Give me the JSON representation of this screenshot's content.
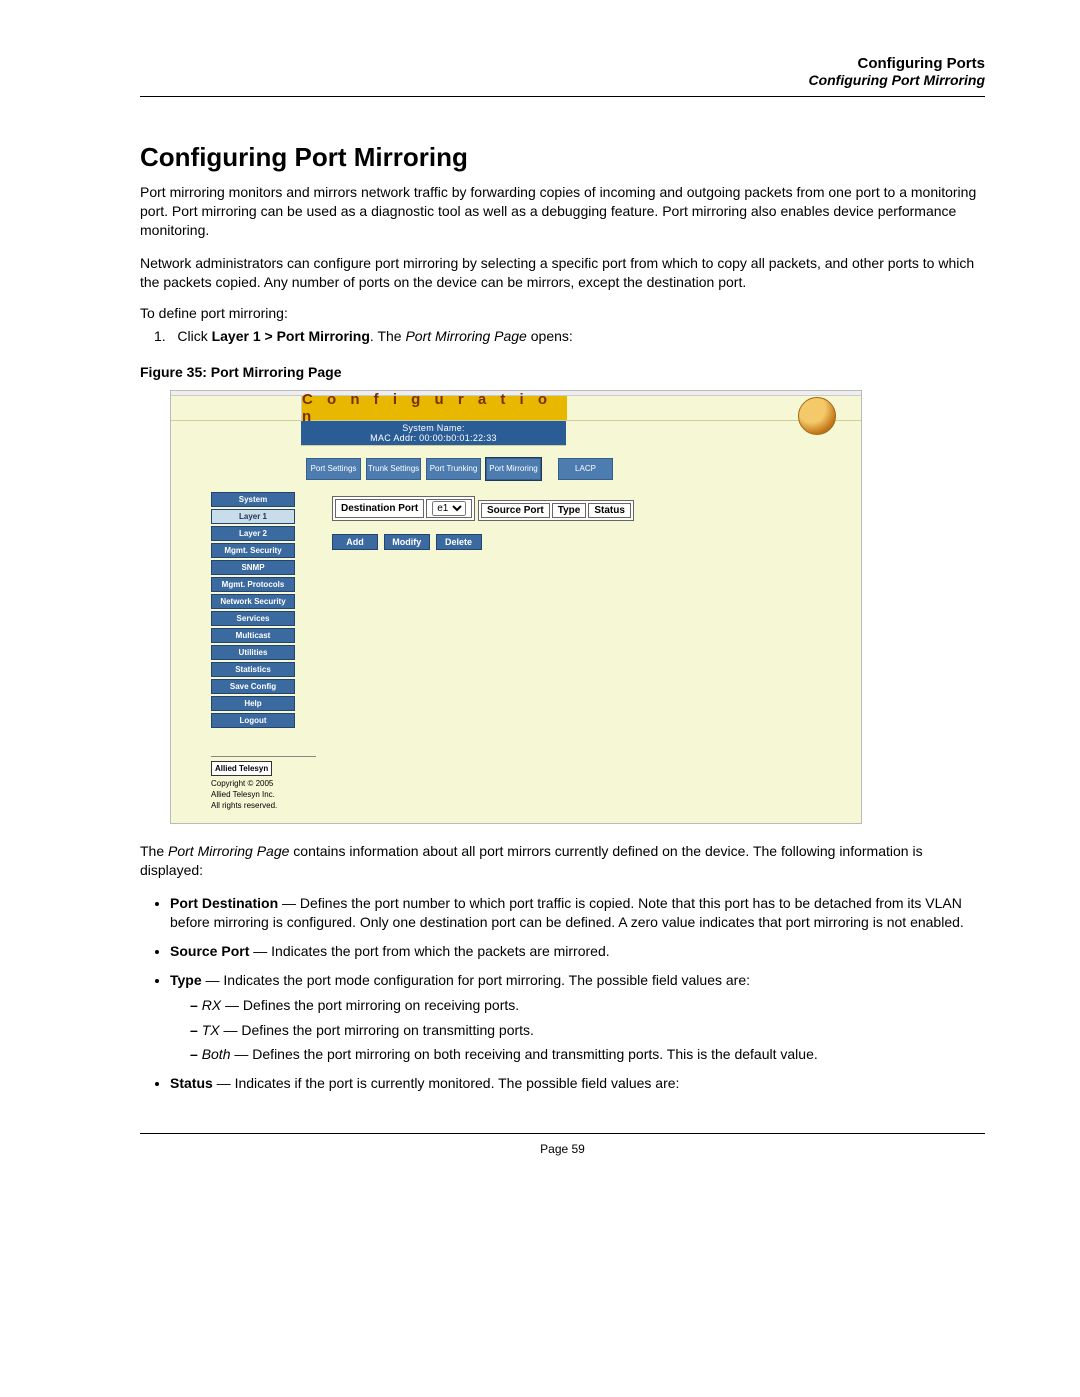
{
  "running_head": {
    "chapter": "Configuring Ports",
    "section": "Configuring Port Mirroring"
  },
  "heading": "Configuring Port Mirroring",
  "para1": "Port mirroring monitors and mirrors network traffic by forwarding copies of incoming and outgoing packets from one port to a monitoring port. Port mirroring can be used as a diagnostic tool as well as a debugging feature. Port mirroring also enables device performance monitoring.",
  "para2": "Network administrators can configure port mirroring by selecting a specific port from which to copy all packets, and other ports to which the packets copied. Any number of ports on the device can be mirrors, except the destination port.",
  "lead": "To define port mirroring:",
  "step1": {
    "num": "1.",
    "pre": "Click ",
    "bold": "Layer 1 > Port Mirroring",
    "mid": ". The ",
    "ital": "Port Mirroring Page",
    "post": " opens:"
  },
  "fig_caption": "Figure 35:  Port Mirroring Page",
  "screenshot": {
    "banner": "C o n f i g u r a t i o n",
    "sys_name_label": "System Name:",
    "mac_label": "MAC Addr:  00:00:b0:01:22:33",
    "tabs": [
      "Port\nSettings",
      "Trunk\nSettings",
      "Port\nTrunking",
      "Port\nMirroring",
      "LACP"
    ],
    "sidebar": [
      "System",
      "Layer 1",
      "Layer 2",
      "Mgmt. Security",
      "SNMP",
      "Mgmt. Protocols",
      "Network Security",
      "Services",
      "Multicast",
      "Utilities",
      "Statistics",
      "Save Config",
      "Help",
      "Logout"
    ],
    "dest_port_label": "Destination Port",
    "dest_port_value": "e1",
    "table_headers": [
      "Source Port",
      "Type",
      "Status"
    ],
    "actions": [
      "Add",
      "Modify",
      "Delete"
    ],
    "brand": "Allied Telesyn",
    "copyright": "Copyright © 2005\nAllied Telesyn Inc.\nAll rights reserved."
  },
  "after_fig": {
    "pre": "The ",
    "ital": "Port Mirroring Page",
    "post": " contains information about all port mirrors currently defined on the device. The following information is displayed:"
  },
  "fields": {
    "dest": {
      "name": "Port Destination",
      "text": " — Defines the port number to which port traffic is copied. Note that this port has to be detached from its VLAN before mirroring is configured. Only one destination port can be defined. A zero value indicates that port mirroring is not enabled."
    },
    "src": {
      "name": "Source Port",
      "text": " — Indicates the port from which the packets are mirrored."
    },
    "type": {
      "name": "Type",
      "text": " — Indicates the port mode configuration for port mirroring. The possible field values are:",
      "sub": {
        "rx": {
          "name": "RX",
          "text": " — Defines the port mirroring on receiving ports."
        },
        "tx": {
          "name": "TX",
          "text": " — Defines the port mirroring on transmitting ports."
        },
        "both": {
          "name": "Both",
          "text": " — Defines the port mirroring on both receiving and transmitting ports. This is the default value."
        }
      }
    },
    "status": {
      "name": "Status",
      "text": " — Indicates if the port is currently monitored. The possible field values are:"
    }
  },
  "page_number": "Page 59"
}
